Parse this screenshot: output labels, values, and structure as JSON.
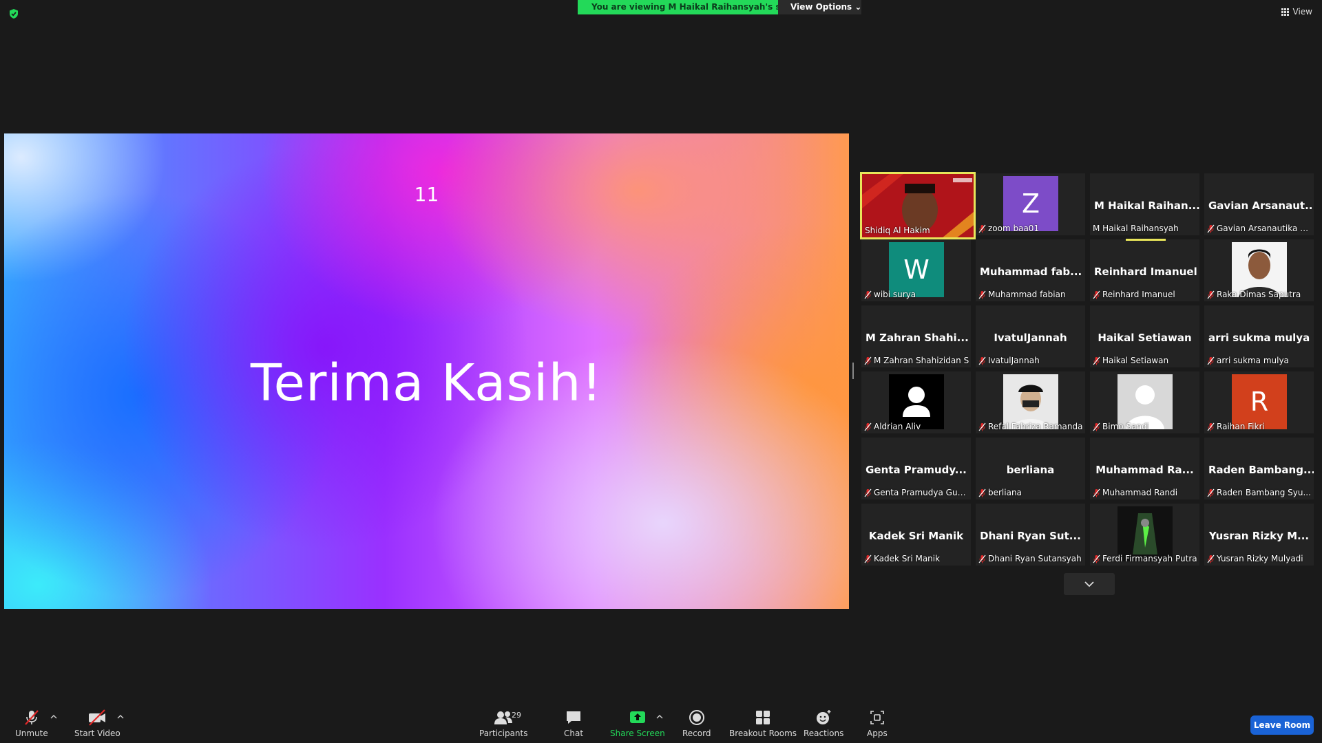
{
  "banner": {
    "message": "You are viewing M  Haikal Raihansyah's screen",
    "view_options": "View Options"
  },
  "top_right": {
    "view_label": "View"
  },
  "slide": {
    "number": "11",
    "title": "Terima Kasih!"
  },
  "gallery": [
    {
      "big": "",
      "name": "Shidiq Al Hakim",
      "kind": "video",
      "muted": false,
      "active": true
    },
    {
      "big": "",
      "name": "zoom baa01",
      "kind": "letter",
      "letter": "Z",
      "avatar_color": "#7d4cc8",
      "muted": true
    },
    {
      "big": "M  Haikal  Raihan...",
      "name": "M Haikal Raihansyah",
      "kind": "name",
      "muted": false
    },
    {
      "big": "Gavian  Arsanaut...",
      "name": "Gavian Arsanautika Al...",
      "kind": "name",
      "muted": true
    },
    {
      "big": "",
      "name": "wibi surya",
      "kind": "letter",
      "letter": "W",
      "avatar_color": "#0f8c7c",
      "muted": true
    },
    {
      "big": "Muhammad  fab...",
      "name": "Muhammad fabian",
      "kind": "name",
      "muted": true
    },
    {
      "big": "Reinhard Imanuel",
      "name": "Reinhard Imanuel",
      "kind": "name",
      "muted": true
    },
    {
      "big": "",
      "name": "Raka Dimas Saputra",
      "kind": "photo-person",
      "muted": true
    },
    {
      "big": "M  Zahran  Shahi...",
      "name": "M Zahran Shahizidan S",
      "kind": "name",
      "muted": true
    },
    {
      "big": "IvatulJannah",
      "name": "IvatulJannah",
      "kind": "name",
      "muted": true
    },
    {
      "big": "Haikal Setiawan",
      "name": "Haikal Setiawan",
      "kind": "name",
      "muted": true
    },
    {
      "big": "arri sukma mulya",
      "name": "arri sukma mulya",
      "kind": "name",
      "muted": true
    },
    {
      "big": "",
      "name": "Aldrian Aliv",
      "kind": "default-avatar",
      "muted": true
    },
    {
      "big": "",
      "name": "Refal Fahriza Ramanda",
      "kind": "photo-cap",
      "muted": true
    },
    {
      "big": "",
      "name": "Bimo Sandi",
      "kind": "photo-silhouette",
      "muted": true
    },
    {
      "big": "",
      "name": "Raihan Fikri",
      "kind": "letter",
      "letter": "R",
      "avatar_color": "#d2401c",
      "muted": true
    },
    {
      "big": "Genta  Pramudy...",
      "name": "Genta Pramudya Gun...",
      "kind": "name",
      "muted": true
    },
    {
      "big": "berliana",
      "name": "berliana",
      "kind": "name",
      "muted": true
    },
    {
      "big": "Muhammad  Ra...",
      "name": "Muhammad Randi",
      "kind": "name",
      "muted": true
    },
    {
      "big": "Raden  Bambang...",
      "name": "Raden Bambang Syu...",
      "kind": "name",
      "muted": true
    },
    {
      "big": "Kadek Sri Manik",
      "name": "Kadek Sri Manik",
      "kind": "name",
      "muted": true
    },
    {
      "big": "Dhani  Ryan  Sut...",
      "name": "Dhani Ryan Sutansyah",
      "kind": "name",
      "muted": true
    },
    {
      "big": "",
      "name": "Ferdi Firmansyah Putra",
      "kind": "photo-game",
      "muted": true
    },
    {
      "big": "Yusran  Rizky  M...",
      "name": "Yusran Rizky Mulyadi",
      "kind": "name",
      "muted": true
    }
  ],
  "toolbar": {
    "unmute": "Unmute",
    "start_video": "Start Video",
    "participants": "Participants",
    "participant_count": "29",
    "chat": "Chat",
    "share_screen": "Share Screen",
    "record": "Record",
    "breakout_rooms": "Breakout Rooms",
    "reactions": "Reactions",
    "apps": "Apps",
    "leave_room": "Leave Room"
  },
  "colors": {
    "banner_green": "#23d959",
    "active_speaker": "#e8e55a",
    "leave_blue": "#1a63d6",
    "mute_red": "#e02828"
  }
}
